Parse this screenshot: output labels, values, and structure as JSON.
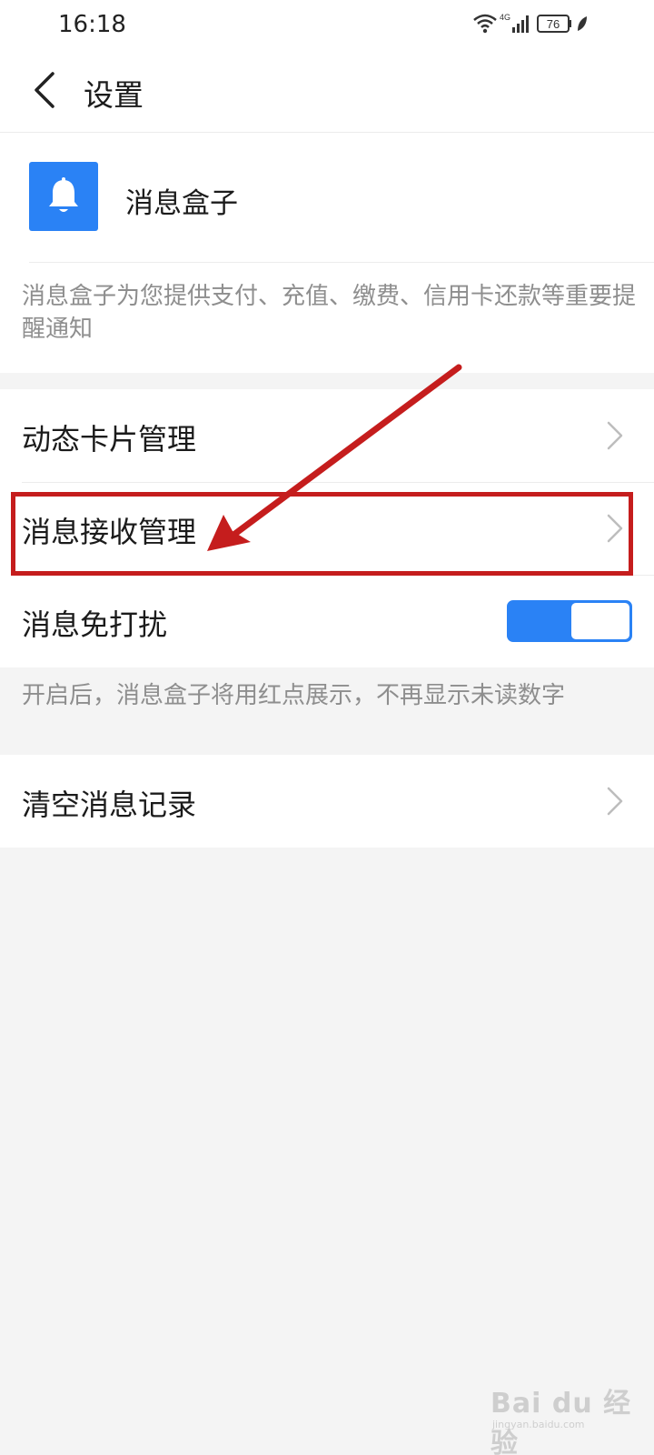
{
  "status_bar": {
    "time": "16:18",
    "network": "4G",
    "battery": "76",
    "icons": [
      "wifi-icon",
      "signal-icon",
      "battery-icon",
      "leaf-icon"
    ]
  },
  "header": {
    "back_icon": "chevron-left-icon",
    "title": "设置"
  },
  "app": {
    "icon": "bell-icon",
    "name": "消息盒子",
    "description": "消息盒子为您提供支付、充值、缴费、信用卡还款等重要提醒通知"
  },
  "settings": {
    "dynamic_card": {
      "label": "动态卡片管理",
      "icon": "chevron-right-icon"
    },
    "message_receive": {
      "label": "消息接收管理",
      "icon": "chevron-right-icon"
    },
    "do_not_disturb": {
      "label": "消息免打扰",
      "toggle_on": true
    },
    "hint": "开启后，消息盒子将用红点展示，不再显示未读数字",
    "clear_records": {
      "label": "清空消息记录",
      "icon": "chevron-right-icon"
    }
  },
  "watermark": {
    "brand": "Bai du 经验",
    "url": "jingyan.baidu.com"
  },
  "colors": {
    "accent": "#2a82f5",
    "annotation": "#c51d1d",
    "background": "#f4f4f4"
  }
}
